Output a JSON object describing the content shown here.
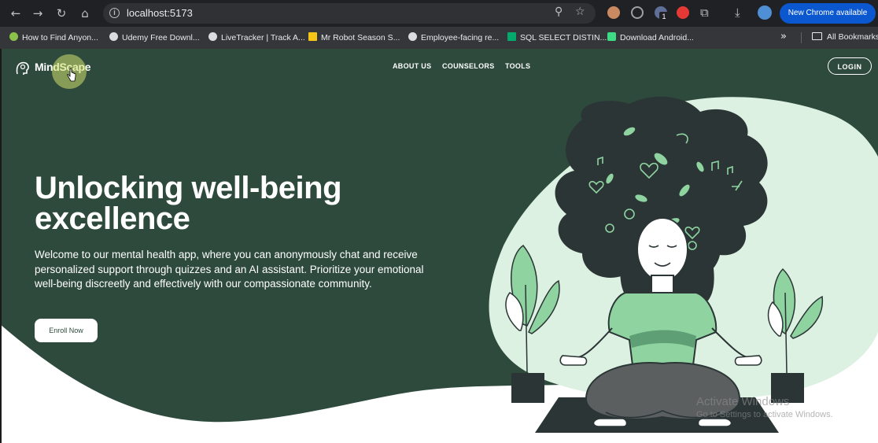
{
  "browser": {
    "url": "localhost:5173",
    "new_chrome_label": "New Chrome available",
    "extension_badge": "1",
    "bookmarks": [
      {
        "label": "How to Find Anyon...",
        "color": "#8bc34a"
      },
      {
        "label": "Udemy Free Downl...",
        "color": "#dadce0"
      },
      {
        "label": "LiveTracker | Track A...",
        "color": "#dadce0"
      },
      {
        "label": "Mr Robot Season S...",
        "color": "#f5c518"
      },
      {
        "label": "Employee-facing re...",
        "color": "#dadce0"
      },
      {
        "label": "SQL SELECT DISTIN...",
        "color": "#04aa6d"
      },
      {
        "label": "Download Android...",
        "color": "#3ddc84"
      }
    ],
    "all_bookmarks_label": "All Bookmarks"
  },
  "site": {
    "brand": "MindScape",
    "nav": {
      "about": "ABOUT US",
      "counselors": "COUNSELORS",
      "tools": "TOOLS"
    },
    "login_label": "LOGIN",
    "hero": {
      "title_line1": "Unlocking well-being",
      "title_line2": "excellence",
      "description": "Welcome to our mental health app, where you can anonymously chat and receive personalized support through quizzes and an AI assistant. Prioritize your emotional well-being discreetly and effectively with our compassionate community.",
      "cta_label": "Enroll Now"
    },
    "colors": {
      "hero_bg": "#2d4a3c",
      "accent_green": "#8ed3a0",
      "soft_mint": "#dcf1e1",
      "dark": "#2b3536"
    }
  },
  "overlay": {
    "activate_title": "Activate Windows",
    "activate_sub": "Go to Settings to activate Windows."
  }
}
